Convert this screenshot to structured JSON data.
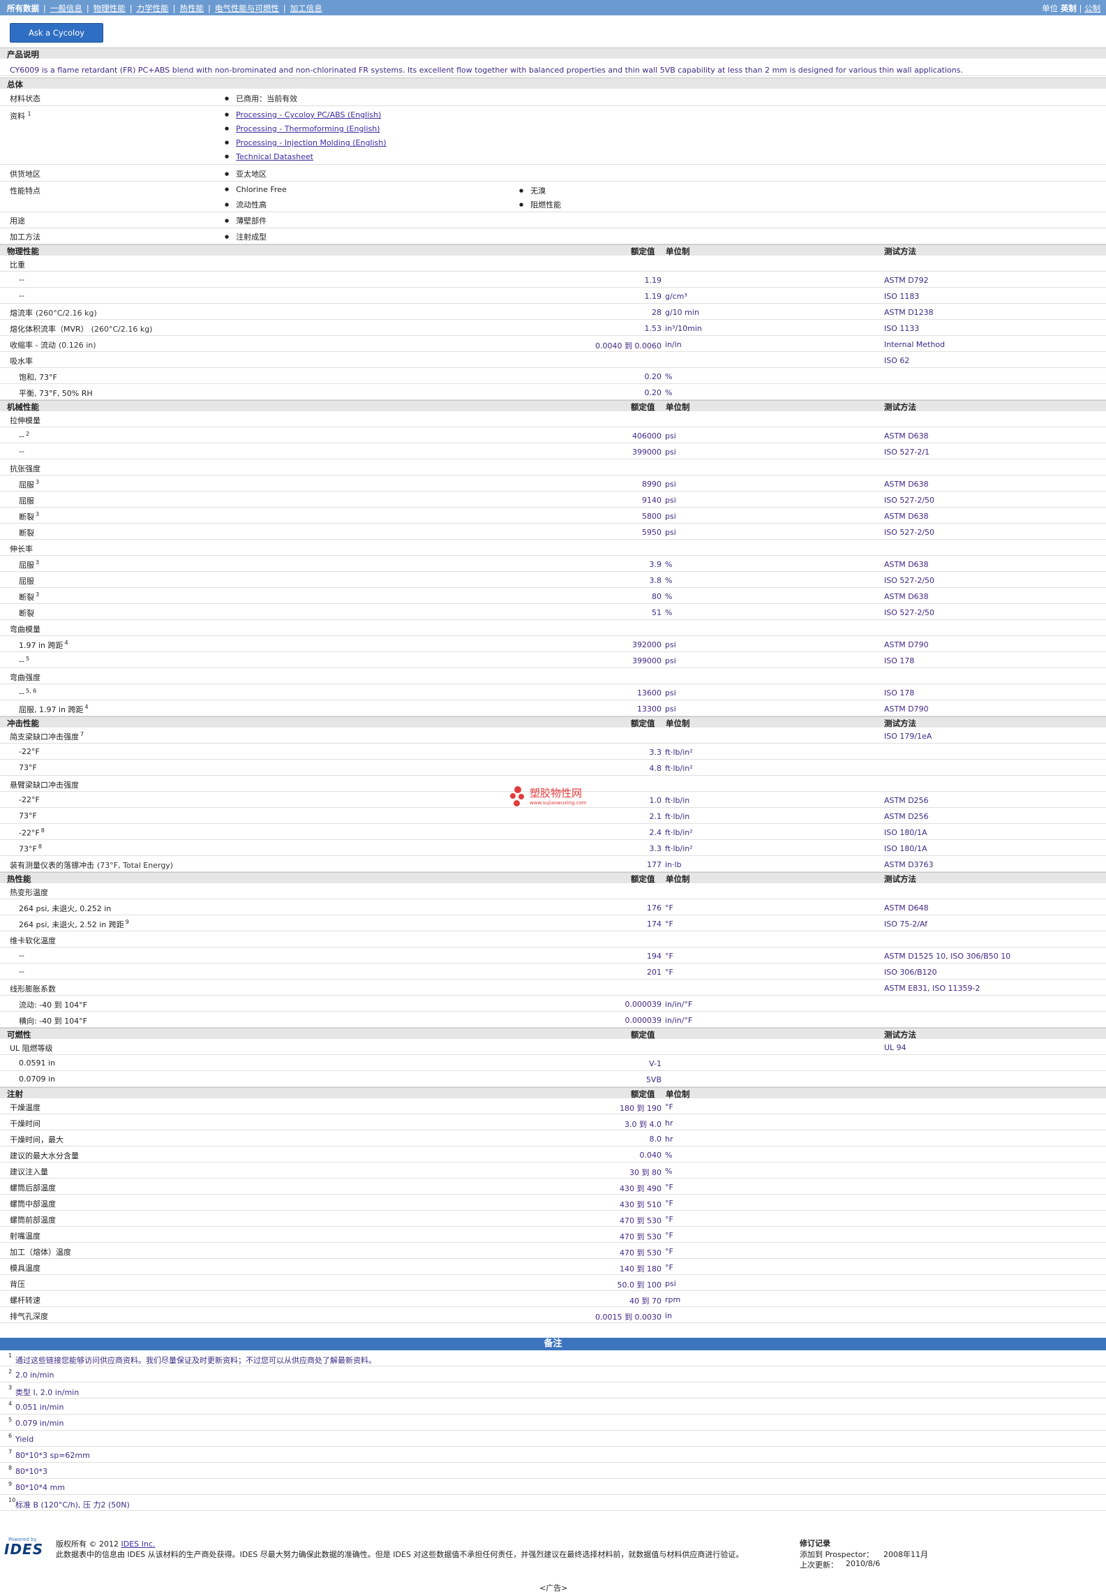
{
  "nav": {
    "items": [
      "所有数据",
      "一般信息",
      "物理性能",
      "力学性能",
      "热性能",
      "电气性能与可燃性",
      "加工信息"
    ],
    "units_label": "单位",
    "unit_english": "英制",
    "unit_metric": "公制"
  },
  "ask_button": "Ask a Cycoloy Engineer",
  "product_description": {
    "header": "产品说明",
    "text": "CY6009 is a flame retardant (FR) PC+ABS blend with non-brominated and non-chlorinated FR systems. Its excellent flow together with balanced properties and thin wall 5VB capability at less than 2 mm is designed for various thin wall applications."
  },
  "general": {
    "header": "总体",
    "material_status_label": "材料状态",
    "material_status": "已商用：当前有效",
    "literature_label": "资料",
    "literature_sup": "1",
    "literature_links": [
      "Processing - Cycoloy PC/ABS (English)",
      "Processing - Thermoforming (English)",
      "Processing - Injection Molding (English)",
      "Technical Datasheet"
    ],
    "availability_label": "供货地区",
    "availability": "亚太地区",
    "features_label": "性能特点",
    "features_col1": [
      "Chlorine Free",
      "流动性高"
    ],
    "features_col2": [
      "无溴",
      "阻燃性能"
    ],
    "uses_label": "用途",
    "uses": "薄壁部件",
    "processing_label": "加工方法",
    "processing": "注射成型"
  },
  "col_headers": {
    "nominal": "额定值",
    "units": "单位制",
    "method": "测试方法"
  },
  "physical": {
    "header": "物理性能",
    "rows": [
      {
        "label": "比重",
        "cond": "",
        "sup": "",
        "val": "",
        "unit": "",
        "method": "",
        "indent": false
      },
      {
        "label": "--",
        "cond": "",
        "sup": "",
        "val": "1.19",
        "unit": "",
        "method": "ASTM D792",
        "indent": true
      },
      {
        "label": "--",
        "cond": "",
        "sup": "",
        "val": "1.19",
        "unit": "g/cm³",
        "method": "ISO 1183",
        "indent": true
      },
      {
        "label": "熔流率",
        "cond": "(260°C/2.16 kg)",
        "sup": "",
        "val": "28",
        "unit": "g/10 min",
        "method": "ASTM D1238",
        "indent": false
      },
      {
        "label": "熔化体积流率（MVR）",
        "cond": "(260°C/2.16 kg)",
        "sup": "",
        "val": "1.53",
        "unit": "in³/10min",
        "method": "ISO 1133",
        "indent": false
      },
      {
        "label": "收缩率 - 流动",
        "cond": "(0.126 in)",
        "sup": "",
        "val": "0.0040 到 0.0060",
        "unit": "in/in",
        "method": "Internal Method",
        "indent": false
      },
      {
        "label": "吸水率",
        "cond": "",
        "sup": "",
        "val": "",
        "unit": "",
        "method": "ISO 62",
        "indent": false
      },
      {
        "label": "饱和, 73°F",
        "cond": "",
        "sup": "",
        "val": "0.20",
        "unit": "%",
        "method": "",
        "indent": true
      },
      {
        "label": "平衡, 73°F, 50% RH",
        "cond": "",
        "sup": "",
        "val": "0.20",
        "unit": "%",
        "method": "",
        "indent": true
      }
    ]
  },
  "mechanical": {
    "header": "机械性能",
    "rows": [
      {
        "label": "拉伸模量",
        "cond": "",
        "sup": "",
        "val": "",
        "unit": "",
        "method": "",
        "indent": false
      },
      {
        "label": "--",
        "cond": "",
        "sup": "2",
        "val": "406000",
        "unit": "psi",
        "method": "ASTM D638",
        "indent": true
      },
      {
        "label": "--",
        "cond": "",
        "sup": "",
        "val": "399000",
        "unit": "psi",
        "method": "ISO 527-2/1",
        "indent": true
      },
      {
        "label": "抗张强度",
        "cond": "",
        "sup": "",
        "val": "",
        "unit": "",
        "method": "",
        "indent": false
      },
      {
        "label": "屈服",
        "cond": "",
        "sup": "3",
        "val": "8990",
        "unit": "psi",
        "method": "ASTM D638",
        "indent": true
      },
      {
        "label": "屈服",
        "cond": "",
        "sup": "",
        "val": "9140",
        "unit": "psi",
        "method": "ISO 527-2/50",
        "indent": true
      },
      {
        "label": "断裂",
        "cond": "",
        "sup": "3",
        "val": "5800",
        "unit": "psi",
        "method": "ASTM D638",
        "indent": true
      },
      {
        "label": "断裂",
        "cond": "",
        "sup": "",
        "val": "5950",
        "unit": "psi",
        "method": "ISO 527-2/50",
        "indent": true
      },
      {
        "label": "伸长率",
        "cond": "",
        "sup": "",
        "val": "",
        "unit": "",
        "method": "",
        "indent": false
      },
      {
        "label": "屈服",
        "cond": "",
        "sup": "3",
        "val": "3.9",
        "unit": "%",
        "method": "ASTM D638",
        "indent": true
      },
      {
        "label": "屈服",
        "cond": "",
        "sup": "",
        "val": "3.8",
        "unit": "%",
        "method": "ISO 527-2/50",
        "indent": true
      },
      {
        "label": "断裂",
        "cond": "",
        "sup": "3",
        "val": "80",
        "unit": "%",
        "method": "ASTM D638",
        "indent": true
      },
      {
        "label": "断裂",
        "cond": "",
        "sup": "",
        "val": "51",
        "unit": "%",
        "method": "ISO 527-2/50",
        "indent": true
      },
      {
        "label": "弯曲模量",
        "cond": "",
        "sup": "",
        "val": "",
        "unit": "",
        "method": "",
        "indent": false
      },
      {
        "label": "1.97 in 跨距",
        "cond": "",
        "sup": "4",
        "val": "392000",
        "unit": "psi",
        "method": "ASTM D790",
        "indent": true
      },
      {
        "label": "--",
        "cond": "",
        "sup": "5",
        "val": "399000",
        "unit": "psi",
        "method": "ISO 178",
        "indent": true
      },
      {
        "label": "弯曲强度",
        "cond": "",
        "sup": "",
        "val": "",
        "unit": "",
        "method": "",
        "indent": false
      },
      {
        "label": "--",
        "cond": "",
        "sup": "5, 6",
        "val": "13600",
        "unit": "psi",
        "method": "ISO 178",
        "indent": true
      },
      {
        "label": "屈服, 1.97 in 跨距",
        "cond": "",
        "sup": "4",
        "val": "13300",
        "unit": "psi",
        "method": "ASTM D790",
        "indent": true
      }
    ]
  },
  "impact": {
    "header": "冲击性能",
    "rows": [
      {
        "label": "简支梁缺口冲击强度",
        "cond": "",
        "sup": "7",
        "val": "",
        "unit": "",
        "method": "ISO 179/1eA",
        "indent": false
      },
      {
        "label": "-22°F",
        "cond": "",
        "sup": "",
        "val": "3.3",
        "unit": "ft·lb/in²",
        "method": "",
        "indent": true
      },
      {
        "label": "73°F",
        "cond": "",
        "sup": "",
        "val": "4.8",
        "unit": "ft·lb/in²",
        "method": "",
        "indent": true
      },
      {
        "label": "悬臂梁缺口冲击强度",
        "cond": "",
        "sup": "",
        "val": "",
        "unit": "",
        "method": "",
        "indent": false
      },
      {
        "label": "-22°F",
        "cond": "",
        "sup": "",
        "val": "1.0",
        "unit": "ft·lb/in",
        "method": "ASTM D256",
        "indent": true
      },
      {
        "label": "73°F",
        "cond": "",
        "sup": "",
        "val": "2.1",
        "unit": "ft·lb/in",
        "method": "ASTM D256",
        "indent": true
      },
      {
        "label": "-22°F",
        "cond": "",
        "sup": "8",
        "val": "2.4",
        "unit": "ft·lb/in²",
        "method": "ISO 180/1A",
        "indent": true
      },
      {
        "label": "73°F",
        "cond": "",
        "sup": "8",
        "val": "3.3",
        "unit": "ft·lb/in²",
        "method": "ISO 180/1A",
        "indent": true
      },
      {
        "label": "装有测量仪表的落镖冲击",
        "cond": "(73°F, Total Energy)",
        "sup": "",
        "val": "177",
        "unit": "in·lb",
        "method": "ASTM D3763",
        "indent": false
      }
    ]
  },
  "thermal": {
    "header": "热性能",
    "rows": [
      {
        "label": "热变形温度",
        "cond": "",
        "sup": "",
        "val": "",
        "unit": "",
        "method": "",
        "indent": false
      },
      {
        "label": "264 psi, 未退火, 0.252 in",
        "cond": "",
        "sup": "",
        "val": "176",
        "unit": "°F",
        "method": "ASTM D648",
        "indent": true
      },
      {
        "label": "264 psi, 未退火, 2.52 in 跨距",
        "cond": "",
        "sup": "9",
        "val": "174",
        "unit": "°F",
        "method": "ISO 75-2/Af",
        "indent": true
      },
      {
        "label": "维卡软化温度",
        "cond": "",
        "sup": "",
        "val": "",
        "unit": "",
        "method": "",
        "indent": false
      },
      {
        "label": "--",
        "cond": "",
        "sup": "",
        "val": "194",
        "unit": "°F",
        "method": "ASTM D1525 10, ISO 306/B50 10",
        "indent": true
      },
      {
        "label": "--",
        "cond": "",
        "sup": "",
        "val": "201",
        "unit": "°F",
        "method": "ISO 306/B120",
        "indent": true
      },
      {
        "label": "线形膨胀系数",
        "cond": "",
        "sup": "",
        "val": "",
        "unit": "",
        "method": "ASTM E831, ISO 11359-2",
        "indent": false
      },
      {
        "label": "流动: -40 到 104°F",
        "cond": "",
        "sup": "",
        "val": "0.000039",
        "unit": "in/in/°F",
        "method": "",
        "indent": true
      },
      {
        "label": "横向: -40 到 104°F",
        "cond": "",
        "sup": "",
        "val": "0.000039",
        "unit": "in/in/°F",
        "method": "",
        "indent": true
      }
    ]
  },
  "flammability": {
    "header": "可燃性",
    "rows": [
      {
        "label": "UL 阻燃等级",
        "cond": "",
        "sup": "",
        "val": "",
        "unit": "",
        "method": "UL 94",
        "indent": false
      },
      {
        "label": "0.0591 in",
        "cond": "",
        "sup": "",
        "val": "V-1",
        "unit": "",
        "method": "",
        "indent": true
      },
      {
        "label": "0.0709 in",
        "cond": "",
        "sup": "",
        "val": "5VB",
        "unit": "",
        "method": "",
        "indent": true
      }
    ]
  },
  "injection": {
    "header": "注射",
    "rows": [
      {
        "label": "干燥温度",
        "val": "180 到 190",
        "unit": "°F"
      },
      {
        "label": "干燥时间",
        "val": "3.0 到 4.0",
        "unit": "hr"
      },
      {
        "label": "干燥时间，最大",
        "val": "8.0",
        "unit": "hr"
      },
      {
        "label": "建议的最大水分含量",
        "val": "0.040",
        "unit": "%"
      },
      {
        "label": "建议注入量",
        "val": "30 到 80",
        "unit": "%"
      },
      {
        "label": "螺筒后部温度",
        "val": "430 到 490",
        "unit": "°F"
      },
      {
        "label": "螺筒中部温度",
        "val": "430 到 510",
        "unit": "°F"
      },
      {
        "label": "螺筒前部温度",
        "val": "470 到 530",
        "unit": "°F"
      },
      {
        "label": "射嘴温度",
        "val": "470 到 530",
        "unit": "°F"
      },
      {
        "label": "加工（熔体）温度",
        "val": "470 到 530",
        "unit": "°F"
      },
      {
        "label": "模具温度",
        "val": "140 到 180",
        "unit": "°F"
      },
      {
        "label": "背压",
        "val": "50.0 到 100",
        "unit": "psi"
      },
      {
        "label": "螺杆转速",
        "val": "40 到 70",
        "unit": "rpm"
      },
      {
        "label": "排气孔深度",
        "val": "0.0015 到 0.0030",
        "unit": "in"
      }
    ]
  },
  "notes": {
    "header": "备注",
    "items": [
      {
        "n": "1",
        "text": "通过这些链接您能够访问供应商资料。我们尽量保证及时更新资料；不过您可以从供应商处了解最新资料。"
      },
      {
        "n": "2",
        "text": "2.0 in/min"
      },
      {
        "n": "3",
        "text": "类型 I, 2.0 in/min"
      },
      {
        "n": "4",
        "text": "0.051 in/min"
      },
      {
        "n": "5",
        "text": "0.079 in/min"
      },
      {
        "n": "6",
        "text": "Yield"
      },
      {
        "n": "7",
        "text": "80*10*3 sp=62mm"
      },
      {
        "n": "8",
        "text": "80*10*3"
      },
      {
        "n": "9",
        "text": "80*10*4 mm"
      },
      {
        "n": "10",
        "text": "标准 B (120°C/h), 压 力2 (50N)"
      }
    ]
  },
  "footer": {
    "powered_by": "Powered by",
    "logo_text": "IDES",
    "copyright": "版权所有 © 2012",
    "copyright_link": "IDES Inc.",
    "disclaimer": "此数据表中的信息由 IDES 从该材料的生产商处获得。IDES 尽最大努力确保此数据的准确性。但是 IDES 对这些数据值不承担任何责任，并强烈建议在最终选择材料前，就数据值与材料供应商进行验证。",
    "revision_title": "修订记录",
    "added_label": "添加到 Prospector：",
    "added_date": "2008年11月",
    "updated_label": "上次更新：",
    "updated_date": "2010/8/6",
    "ad": "<广告>"
  },
  "watermark": {
    "name": "塑胶物性网",
    "url": "www.sujiaowuxing.com"
  },
  "colors": {
    "topbar": "#6b9ad0",
    "button": "#2f6fc3",
    "notes_bar": "#3c75bd",
    "value_text": "#3c2a85"
  }
}
